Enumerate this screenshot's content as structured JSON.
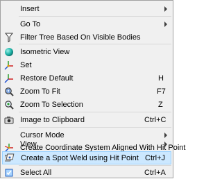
{
  "menu": {
    "items": [
      {
        "label": "Insert",
        "submenu": true
      },
      {
        "label": "Go To",
        "submenu": true
      },
      {
        "label": "Filter Tree Based On Visible Bodies",
        "icon": "filter-icon"
      },
      {
        "label": "Isometric View",
        "icon": "isometric-sphere-icon"
      },
      {
        "label": "Set",
        "icon": "axis-icon"
      },
      {
        "label": "Restore Default",
        "shortcut": "H",
        "icon": "axis-restore-icon"
      },
      {
        "label": "Zoom To Fit",
        "shortcut": "F7",
        "icon": "zoom-fit-icon"
      },
      {
        "label": "Zoom To Selection",
        "shortcut": "Z",
        "icon": "zoom-selection-icon"
      },
      {
        "label": "Image to Clipboard",
        "shortcut": "Ctrl+C",
        "icon": "camera-icon"
      },
      {
        "label": "Cursor Mode",
        "submenu": true
      },
      {
        "label": "View",
        "submenu": true
      },
      {
        "label": "Create Coordinate System Aligned With Hit Point",
        "icon": "coordinate-system-icon"
      },
      {
        "label": "Create a Spot Weld using Hit Point",
        "shortcut": "Ctrl+J",
        "icon": "spot-weld-icon",
        "highlighted": true
      },
      {
        "label": "Select All",
        "shortcut": "Ctrl+A",
        "icon": "select-all-icon"
      }
    ]
  },
  "colors": {
    "highlight_bg": "#cce8ff",
    "highlight_border": "#99d1ff",
    "menu_bg": "#f0f0f0"
  }
}
